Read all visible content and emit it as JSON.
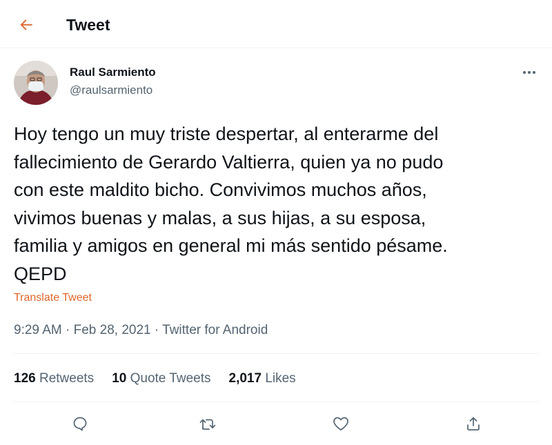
{
  "header": {
    "title": "Tweet",
    "back_icon": "arrow-left-icon",
    "accent_color": "#e0662a"
  },
  "author": {
    "name": "Raul Sarmiento",
    "handle": "@raulsarmiento",
    "avatar_icon": "avatar-photo"
  },
  "tweet": {
    "text": "Hoy tengo un muy triste despertar, al enterarme del\nfallecimiento de Gerardo Valtierra, quien ya no pudo\ncon este maldito bicho. Convivimos muchos años,\nvivimos buenas y malas, a sus hijas, a su esposa,\nfamilia y amigos en general mi más sentido pésame.\nQEPD",
    "translate_label": "Translate Tweet",
    "time": "9:29 AM",
    "date": "Feb 28, 2021",
    "source": "Twitter for Android",
    "separator": "·"
  },
  "stats": {
    "retweets_count": "126",
    "retweets_label": "Retweets",
    "quotes_count": "10",
    "quotes_label": "Quote Tweets",
    "likes_count": "2,017",
    "likes_label": "Likes"
  },
  "actions": {
    "reply_icon": "reply-icon",
    "retweet_icon": "retweet-icon",
    "like_icon": "heart-icon",
    "share_icon": "share-icon",
    "more_icon": "more-horizontal-icon"
  }
}
